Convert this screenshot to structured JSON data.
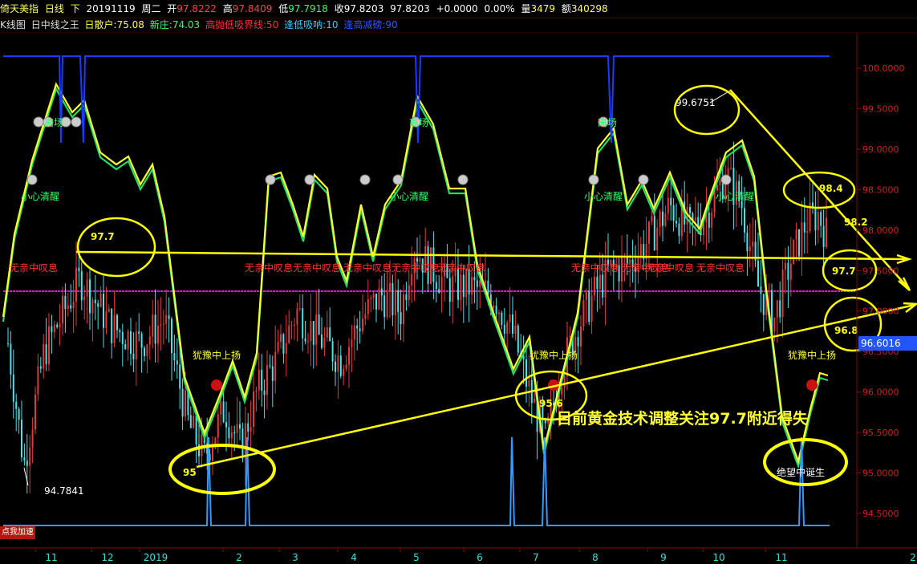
{
  "header": {
    "name": "倚天美指",
    "period": "日线",
    "nav": "下",
    "date": "20191119",
    "weekday": "周二",
    "open_label": "开",
    "open": "97.8222",
    "high_label": "高",
    "high": "97.8409",
    "low_label": "低",
    "low": "97.7918",
    "close_label": "收",
    "close": "97.8203",
    "last": "97.8203",
    "change": "+0.0000",
    "change_pct": "0.00%",
    "volume_label": "量",
    "volume": "3479",
    "amount_label": "额",
    "amount": "340298"
  },
  "indicator_bar": {
    "chart_name": "K线图",
    "indicator": "日中线之王",
    "retail": "日散户:75.08",
    "new_vol": "新庄:74.03",
    "hi_low_line": "高抛低吸界线:50",
    "low_suck": "逢低吸呐:10",
    "high_reduce": "逢高减磅:90"
  },
  "colors": {
    "background": "#000000",
    "axis": "#8b0000",
    "up_candle": "#e03a3a",
    "down_candle": "#4fe0e8",
    "fast_line": "#ffff33",
    "slow_line": "#22dd66",
    "signal_line": "#1a3cff",
    "low_signal_line": "#3399ff",
    "mid_line": "#ff33ff",
    "annotation": "#ffff00"
  },
  "chart_data": {
    "type": "candlestick",
    "ylim": [
      94.0,
      100.5
    ],
    "yticks": [
      "100.0000",
      "99.5000",
      "99.0000",
      "98.5000",
      "98.0000",
      "97.5000",
      "97.0000",
      "96.5000",
      "96.0000",
      "95.5000",
      "95.0000",
      "94.5000"
    ],
    "ytick_values": [
      100.0,
      99.5,
      99.0,
      98.5,
      98.0,
      97.5,
      97.0,
      96.5,
      96.0,
      95.5,
      95.0,
      94.5
    ],
    "current_price": "96.6016",
    "current_price_value": 96.6016,
    "xticks": [
      "11",
      "12",
      "2019",
      "2",
      "3",
      "4",
      "5",
      "6",
      "7",
      "8",
      "9",
      "10",
      "11"
    ],
    "xaxis_right_label": "2",
    "period_high_label": "99.6751",
    "period_low_label": "94.7841",
    "annotations": {
      "circle_97_7_left": "97.7",
      "circle_95": "95",
      "circle_95_6": "95.6",
      "circle_98_4": "98.4",
      "label_98_2": "98.2",
      "circle_97_7_right": "97.7",
      "circle_96_8": "96.8",
      "despair": "绝望中诞生",
      "headline": "目前黄金技术调整关注97.7附近得失"
    },
    "signals": {
      "sell": "离场",
      "caution": "小心清醒",
      "wait": "无亲中叹息",
      "hope": "犹豫中上扬"
    }
  },
  "ui": {
    "speed_button": "点我加速"
  }
}
